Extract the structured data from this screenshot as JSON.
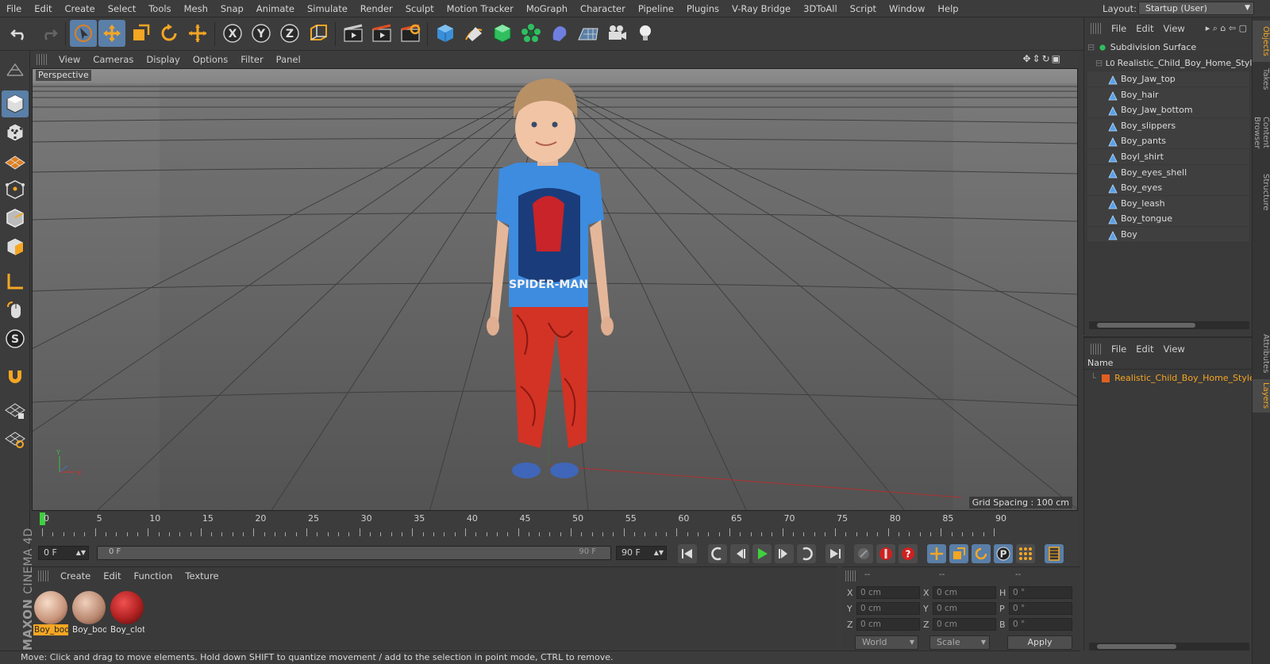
{
  "menu": [
    "File",
    "Edit",
    "Create",
    "Select",
    "Tools",
    "Mesh",
    "Snap",
    "Animate",
    "Simulate",
    "Render",
    "Sculpt",
    "Motion Tracker",
    "MoGraph",
    "Character",
    "Pipeline",
    "Plugins",
    "V-Ray Bridge",
    "3DToAll",
    "Script",
    "Window",
    "Help"
  ],
  "layout": {
    "label": "Layout:",
    "value": "Startup (User)"
  },
  "viewport": {
    "menu": [
      "View",
      "Cameras",
      "Display",
      "Options",
      "Filter",
      "Panel"
    ],
    "camera": "Perspective",
    "grid_spacing": "Grid Spacing : 100 cm"
  },
  "timeline": {
    "ticks": [
      "0",
      "5",
      "10",
      "15",
      "20",
      "25",
      "30",
      "35",
      "40",
      "45",
      "50",
      "55",
      "60",
      "65",
      "70",
      "75",
      "80",
      "85",
      "90"
    ],
    "current_frame": "0 F",
    "start_field": "0 F",
    "range_start": "0 F",
    "range_end": "90 F",
    "end_field": "90 F"
  },
  "materials": {
    "menu": [
      "Create",
      "Edit",
      "Function",
      "Texture"
    ],
    "items": [
      "Boy_bod",
      "Boy_bod",
      "Boy_clot"
    ]
  },
  "coordinates": {
    "headers": [
      "--",
      "--",
      "--"
    ],
    "rows": [
      {
        "a": "X",
        "av": "0 cm",
        "b": "X",
        "bv": "0 cm",
        "c": "H",
        "cv": "0 °"
      },
      {
        "a": "Y",
        "av": "0 cm",
        "b": "Y",
        "bv": "0 cm",
        "c": "P",
        "cv": "0 °"
      },
      {
        "a": "Z",
        "av": "0 cm",
        "b": "Z",
        "bv": "0 cm",
        "c": "B",
        "cv": "0 °"
      }
    ],
    "space": "World",
    "mode": "Scale",
    "apply": "Apply"
  },
  "objects": {
    "menu": [
      "File",
      "Edit",
      "View"
    ],
    "root": "Subdivision Surface",
    "group": "Realistic_Child_Boy_Home_Style",
    "children": [
      "Boy_Jaw_top",
      "Boy_hair",
      "Boy_Jaw_bottom",
      "Boy_slippers",
      "Boy_pants",
      "Boyl_shirt",
      "Boy_eyes_shell",
      "Boy_eyes",
      "Boy_leash",
      "Boy_tongue",
      "Boy"
    ]
  },
  "layers": {
    "menu": [
      "File",
      "Edit",
      "View"
    ],
    "header": "Name",
    "item": "Realistic_Child_Boy_Home_Style"
  },
  "side_tabs": [
    "Objects",
    "Takes",
    "Content Browser",
    "Structure",
    "Attributes",
    "Layers"
  ],
  "branding": {
    "brand": "MAXON",
    "product": "CINEMA 4D"
  },
  "status": "Move: Click and drag to move elements. Hold down SHIFT to quantize movement / add to the selection in point mode, CTRL to remove.",
  "colors": {
    "accent": "#f5a623",
    "active_tool": "#5a7fa8",
    "panel": "#3a3a3a"
  }
}
